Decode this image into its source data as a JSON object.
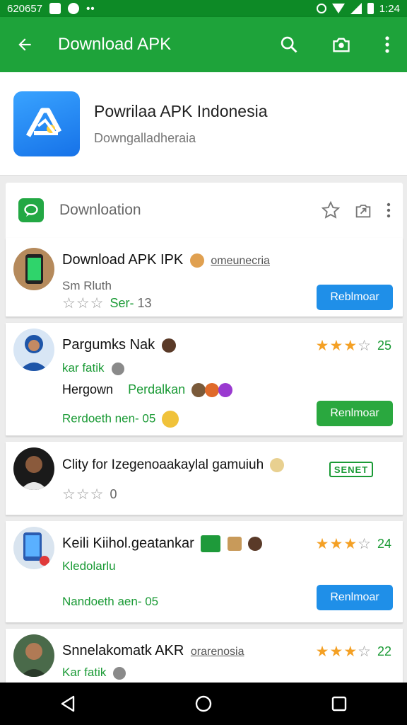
{
  "status_bar": {
    "left_text": "620657",
    "time": "1:24"
  },
  "app_bar": {
    "title": "Download APK"
  },
  "header": {
    "title": "Powrilaa APK Indonesia",
    "subtitle": "Downgalladheraia"
  },
  "section": {
    "title": "Downloation"
  },
  "items": [
    {
      "title": "Download APK IPK",
      "link": "omeunecria",
      "line1": "Sm Rluth",
      "stars": 0,
      "rating_label": "Ser-",
      "rating_value": "13",
      "button": "Reblmoar",
      "button_color": "#1f8fe8"
    },
    {
      "title": "Pargumks Nak",
      "line1": "kar fatik",
      "line2a": "Hergown",
      "line2b": "Perdalkan",
      "line3": "Rerdoeth nen- 05",
      "stars": 3,
      "rating_value": "25",
      "button": "Renlmoar",
      "button_color": "#2aa83f"
    },
    {
      "title": "Clity for Izegenoaakaylal gamuiuh",
      "tag": "SENET",
      "stars": 0,
      "rating_value": "0"
    },
    {
      "title": "Keili Kiihol.geatankar",
      "line1": "Kledolarlu",
      "line3": "Nandoeth aen- 05",
      "stars": 3,
      "rating_value": "24",
      "button": "Renlmoar",
      "button_color": "#1f8fe8"
    },
    {
      "title": "Snnelakomatk AKR",
      "link": "orarenosia",
      "line1": "Kar fatik",
      "stars": 3,
      "rating_value": "22"
    }
  ],
  "colors": {
    "app_bar": "#1ea33a",
    "accent_green": "#1a9a35",
    "star": "#f4a024"
  }
}
